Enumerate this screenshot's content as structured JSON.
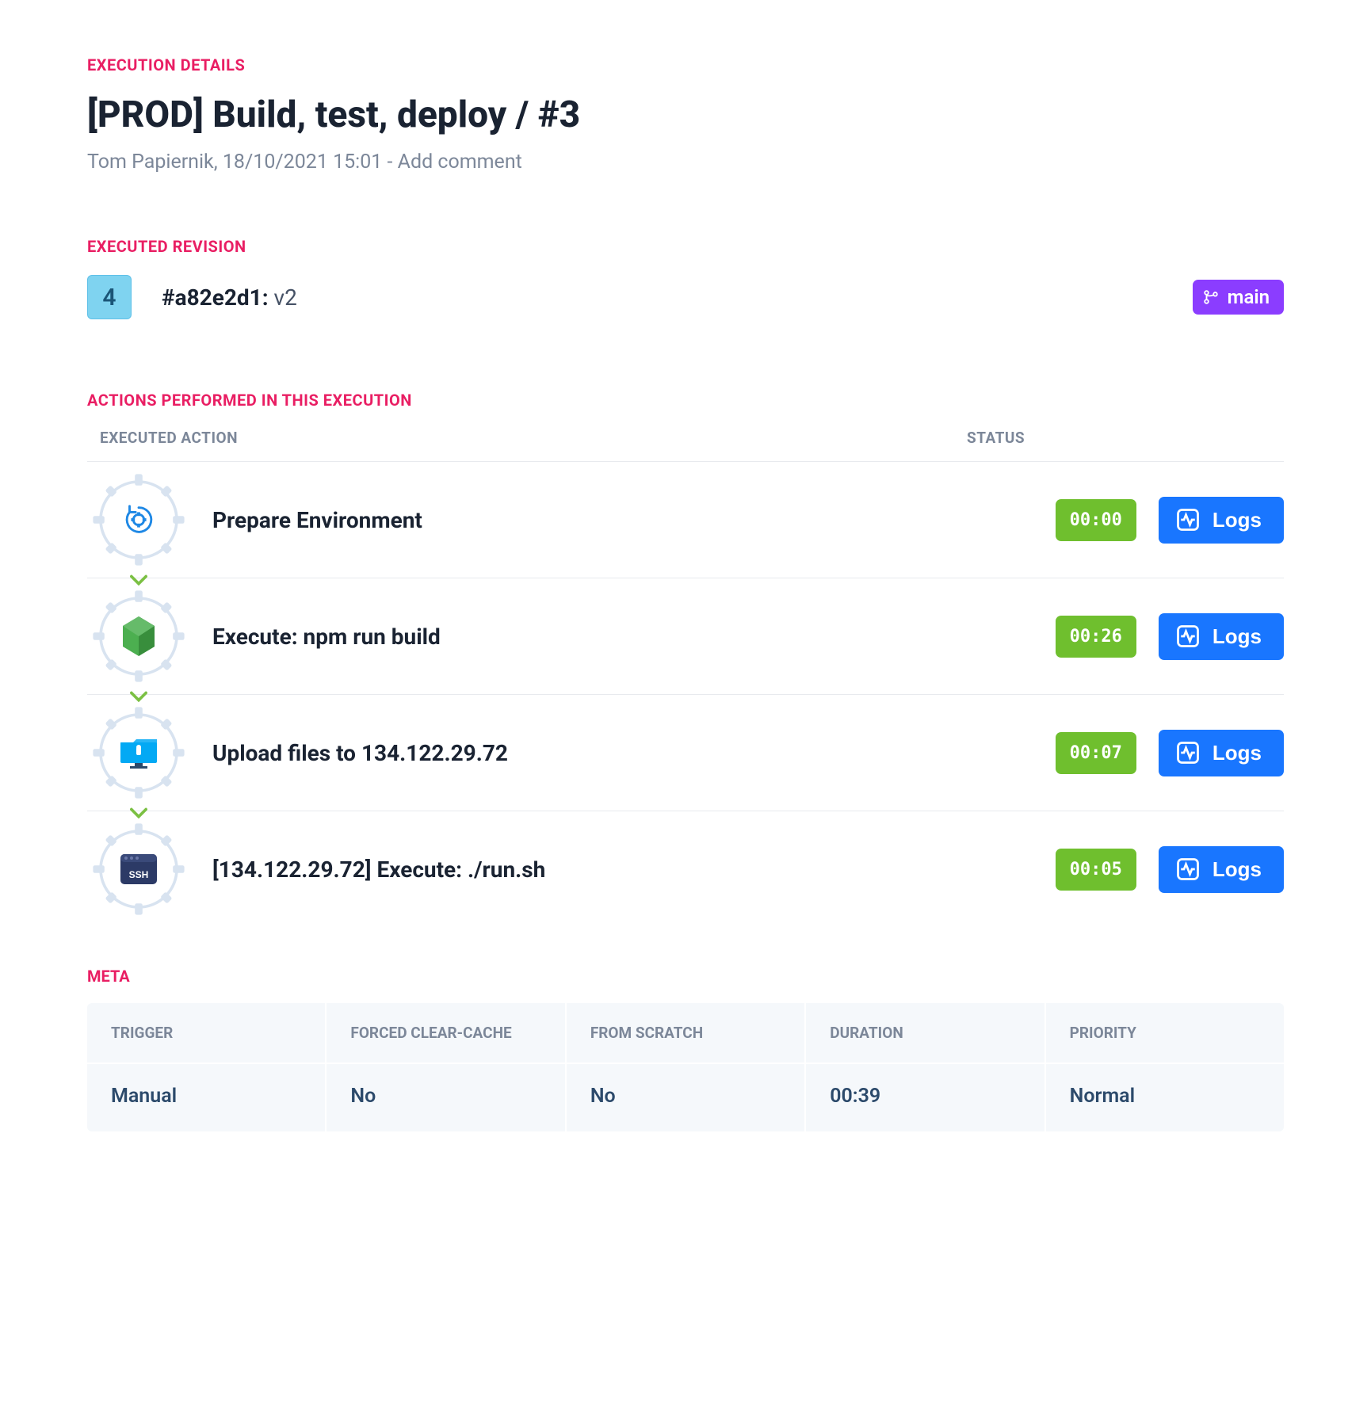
{
  "sections": {
    "execution_details": "EXECUTION DETAILS",
    "executed_revision": "EXECUTED REVISION",
    "actions_performed": "ACTIONS PERFORMED IN THIS EXECUTION",
    "meta": "META"
  },
  "title": "[PROD] Build, test, deploy / #3",
  "author_line": "Tom Papiernik, 18/10/2021 15:01 - ",
  "add_comment_label": "Add comment",
  "revision": {
    "badge_number": "4",
    "hash": "#a82e2d1:",
    "message": " v2",
    "branch": "main"
  },
  "columns": {
    "executed_action": "EXECUTED ACTION",
    "status": "STATUS"
  },
  "logs_label": "Logs",
  "actions": [
    {
      "icon": "prepare",
      "name": "Prepare Environment",
      "duration": "00:00"
    },
    {
      "icon": "node",
      "name": "Execute: npm run build",
      "duration": "00:26"
    },
    {
      "icon": "upload",
      "name": "Upload files to 134.122.29.72",
      "duration": "00:07"
    },
    {
      "icon": "ssh",
      "name": "[134.122.29.72] Execute: ./run.sh",
      "duration": "00:05"
    }
  ],
  "meta": {
    "headers": {
      "trigger": "TRIGGER",
      "forced_clear_cache": "FORCED CLEAR-CACHE",
      "from_scratch": "FROM SCRATCH",
      "duration": "DURATION",
      "priority": "PRIORITY"
    },
    "values": {
      "trigger": "Manual",
      "forced_clear_cache": "No",
      "from_scratch": "No",
      "duration": "00:39",
      "priority": "Normal"
    }
  }
}
